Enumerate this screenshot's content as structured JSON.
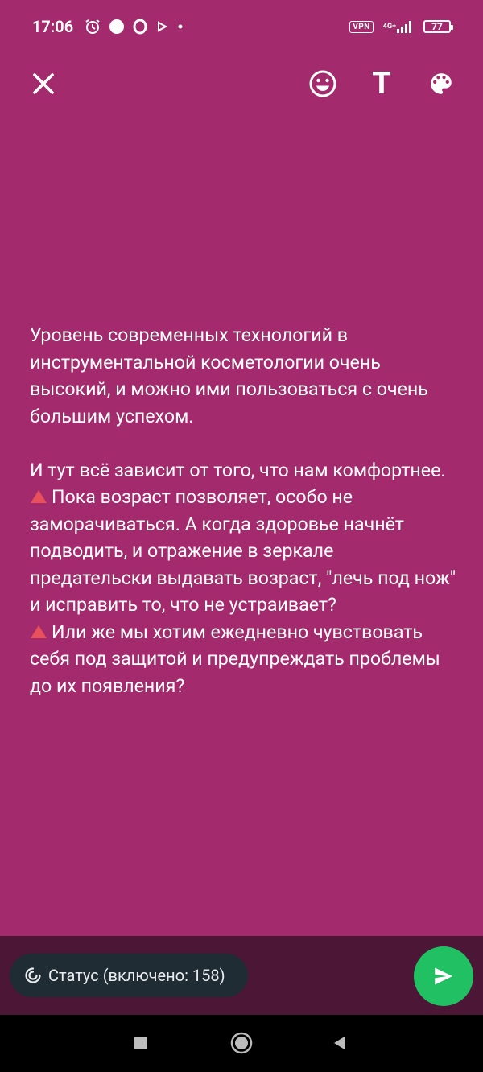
{
  "status_bar": {
    "time": "17:06",
    "vpn": "VPN",
    "network": "4G+",
    "battery": "77"
  },
  "toolbar": {
    "icons": [
      "close-icon",
      "emoji-icon",
      "text-icon",
      "palette-icon"
    ],
    "text_label": "T"
  },
  "status_text": {
    "background_color": "#a32a6c",
    "paragraphs": [
      "Уровень современных технологий в инструментальной косметологии очень высокий, и можно ими пользоваться с очень большим успехом.",
      "И тут всё зависит от того, что нам комфортнее.",
      "Пока возраст позволяет, особо не заморачиваться. А когда здоровье начнёт подводить, и отражение в зеркале предательски выдавать возраст, \"лечь под нож\" и исправить то, что не устраивает?",
      "Или же мы хотим ежедневно чувствовать себя под защитой и предупреждать проблемы до их появления?"
    ]
  },
  "footer": {
    "audience_label": "Статус (включено: 158)",
    "send_color": "#21c063"
  },
  "nav": {
    "icons": [
      "recents-icon",
      "home-icon",
      "back-icon"
    ]
  }
}
